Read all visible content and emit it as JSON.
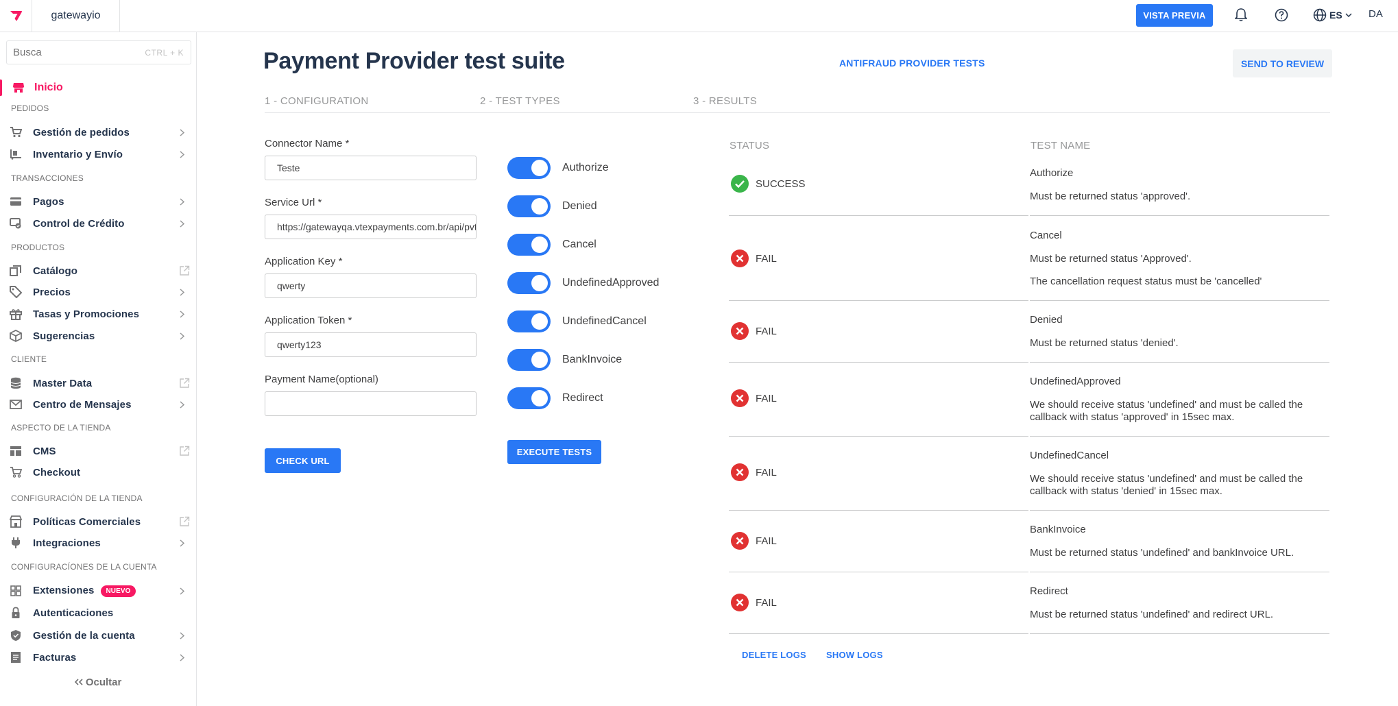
{
  "topbar": {
    "account": "gatewayio",
    "preview_label": "VISTA PREVIA",
    "lang": "ES",
    "user": "DA"
  },
  "sidebar": {
    "search_placeholder": "Busca",
    "search_hint": "CTRL + K",
    "active": "Inicio",
    "sections": [
      "PEDIDOS",
      "TRANSACCIONES",
      "PRODUCTOS",
      "CLIENTE",
      "ASPECTO DE LA TIENDA",
      "CONFIGURACIÓN DE LA TIENDA",
      "CONFIGURACÍONES DE LA CUENTA"
    ],
    "items": [
      "Gestión de pedidos",
      "Inventario y Envío",
      "Pagos",
      "Control de Crédito",
      "Catálogo",
      "Precios",
      "Tasas y Promociones",
      "Sugerencias",
      "Master Data",
      "Centro de Mensajes",
      "CMS",
      "Checkout",
      "Políticas Comerciales",
      "Integraciones",
      "Extensiones",
      "Autenticaciones",
      "Gestión de la cuenta",
      "Facturas"
    ],
    "new_badge": "NUEVO",
    "hide_label": "Ocultar"
  },
  "main": {
    "title": "Payment Provider test suite",
    "antifraud_link": "ANTIFRAUD PROVIDER TESTS",
    "review_button": "SEND TO REVIEW",
    "steps": [
      "1 - CONFIGURATION",
      "2 - TEST TYPES",
      "3 - RESULTS"
    ]
  },
  "form": {
    "connector_label": "Connector Name *",
    "connector_value": "Teste",
    "service_label": "Service Url *",
    "service_value": "https://gatewayqa.vtexpayments.com.br/api/pvt",
    "appkey_label": "Application Key *",
    "appkey_value": "qwerty",
    "apptoken_label": "Application Token *",
    "apptoken_value": "qwerty123",
    "payname_label": "Payment Name(optional)",
    "payname_value": "",
    "check_button": "CHECK URL"
  },
  "tests": {
    "toggles": [
      "Authorize",
      "Denied",
      "Cancel",
      "UndefinedApproved",
      "UndefinedCancel",
      "BankInvoice",
      "Redirect"
    ],
    "execute_button": "EXECUTE TESTS"
  },
  "results": {
    "status_header": "STATUS",
    "name_header": "TEST NAME",
    "rows": [
      {
        "status": "SUCCESS",
        "name": "Authorize",
        "lines": [
          "Must be returned status 'approved'."
        ]
      },
      {
        "status": "FAIL",
        "name": "Cancel",
        "lines": [
          "Must be returned status 'Approved'.",
          "The cancellation request status must be 'cancelled'"
        ]
      },
      {
        "status": "FAIL",
        "name": "Denied",
        "lines": [
          "Must be returned status 'denied'."
        ]
      },
      {
        "status": "FAIL",
        "name": "UndefinedApproved",
        "lines": [
          "We should receive status 'undefined' and must be called the",
          "callback with status 'approved' in 15sec max."
        ]
      },
      {
        "status": "FAIL",
        "name": "UndefinedCancel",
        "lines": [
          "We should receive status 'undefined' and must be called the",
          "callback with status 'denied' in 15sec max."
        ]
      },
      {
        "status": "FAIL",
        "name": "BankInvoice",
        "lines": [
          "Must be returned status 'undefined' and bankInvoice URL."
        ]
      },
      {
        "status": "FAIL",
        "name": "Redirect",
        "lines": [
          "Must be returned status 'undefined' and redirect URL."
        ]
      }
    ],
    "delete_logs": "DELETE LOGS",
    "show_logs": "SHOW LOGS"
  },
  "colors": {
    "accent": "#2978f5",
    "brand": "#f71963",
    "success": "#3ab54a",
    "fail": "#e13232"
  }
}
